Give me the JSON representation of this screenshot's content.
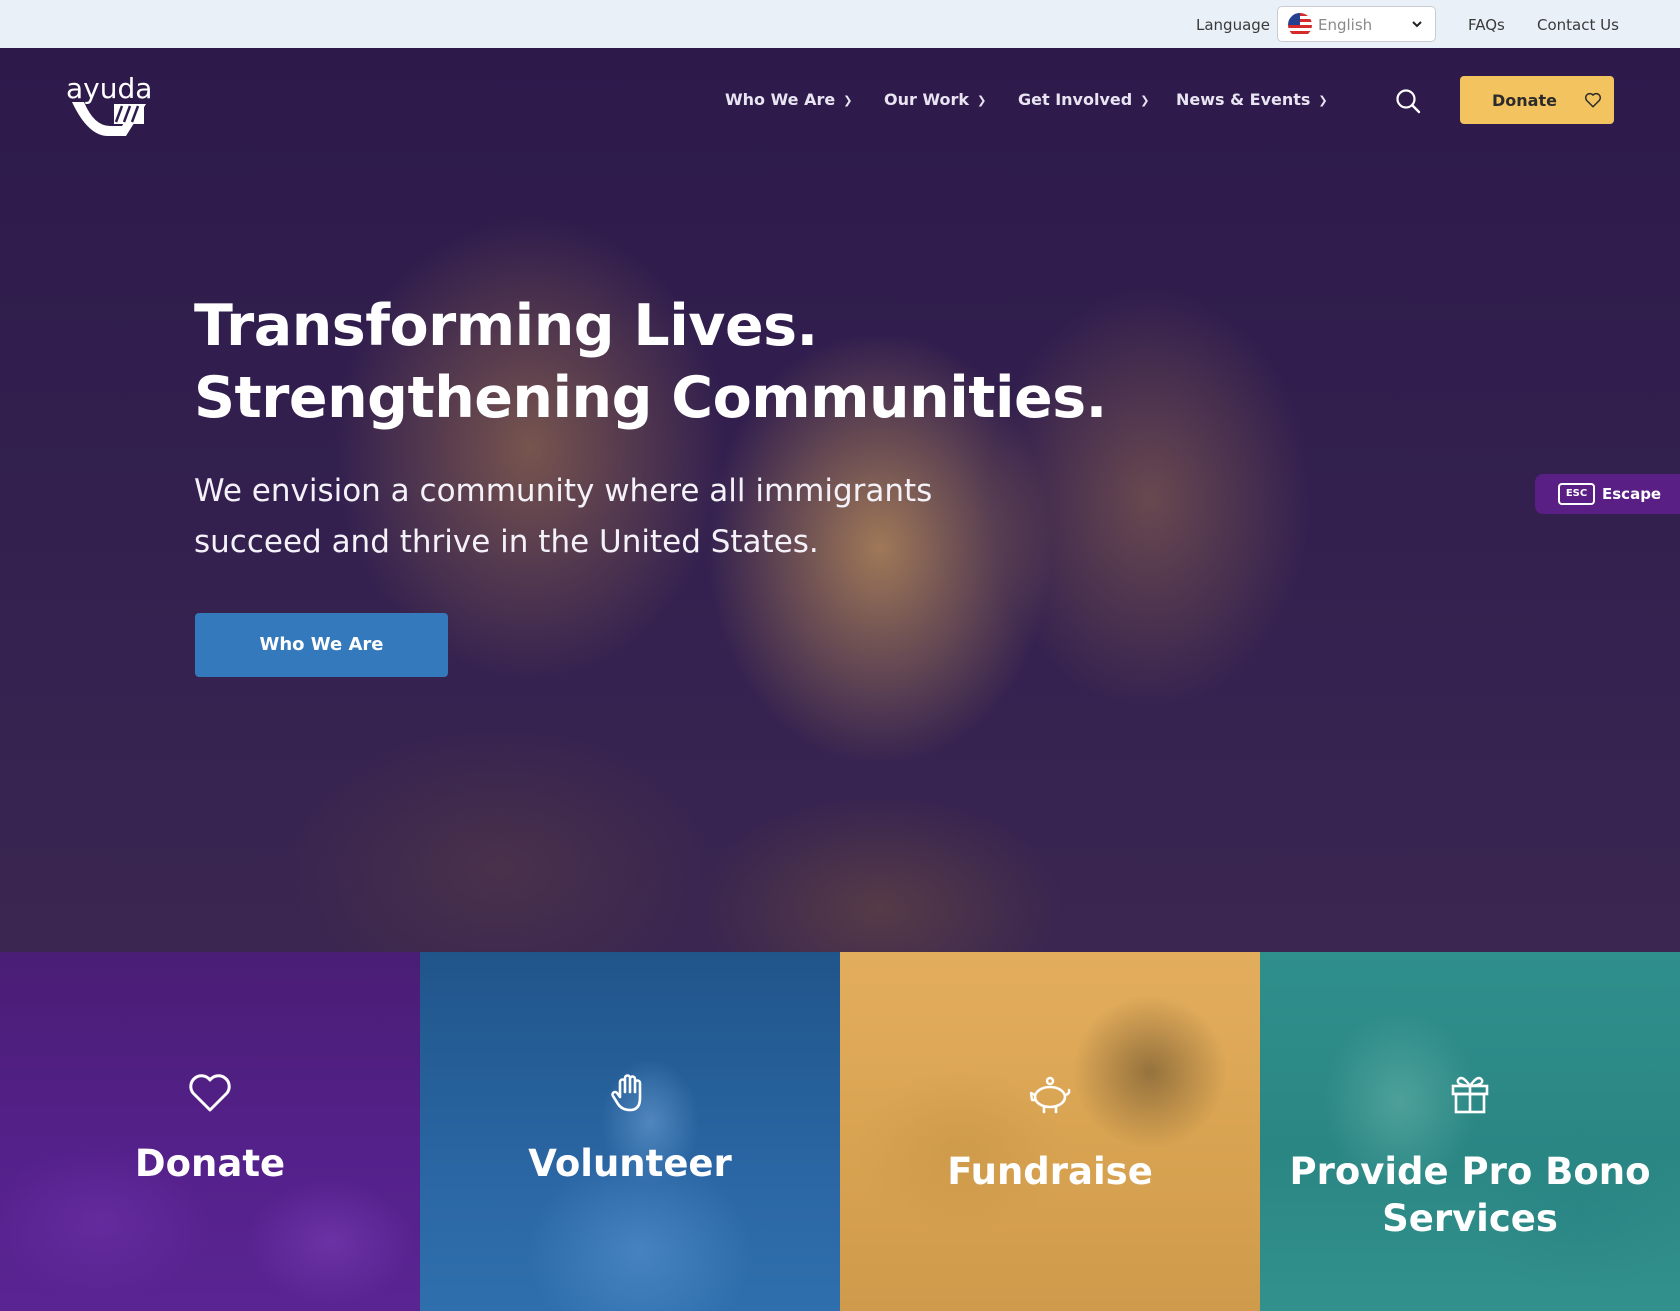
{
  "utility": {
    "language_label": "Language",
    "language_value": "English",
    "faqs": "FAQs",
    "contact": "Contact Us"
  },
  "header": {
    "logo_text": "ayuda",
    "nav": [
      {
        "label": "Who We Are"
      },
      {
        "label": "Our Work"
      },
      {
        "label": "Get Involved"
      },
      {
        "label": "News & Events"
      }
    ],
    "donate_label": "Donate"
  },
  "hero": {
    "title_line1": "Transforming Lives.",
    "title_line2": "Strengthening Communities.",
    "subtitle": "We envision a community where all immigrants succeed and thrive in the United States.",
    "cta_label": "Who We Are"
  },
  "escape": {
    "key": "ESC",
    "label": "Escape"
  },
  "tiles": [
    {
      "label": "Donate",
      "icon": "heart-icon",
      "color": "#54208a"
    },
    {
      "label": "Volunteer",
      "icon": "hand-icon",
      "color": "#2a66a3"
    },
    {
      "label": "Fundraise",
      "icon": "piggy-bank-icon",
      "color": "#d9a452"
    },
    {
      "label": "Provide Pro Bono Services",
      "icon": "gift-icon",
      "color": "#2a8683"
    }
  ],
  "colors": {
    "hero_purple": "#2f1a4e",
    "donate_yellow": "#f3c35f",
    "cta_blue": "#3479bb",
    "escape_purple": "#5a1f85",
    "utility_bg": "#eaf0f8"
  }
}
